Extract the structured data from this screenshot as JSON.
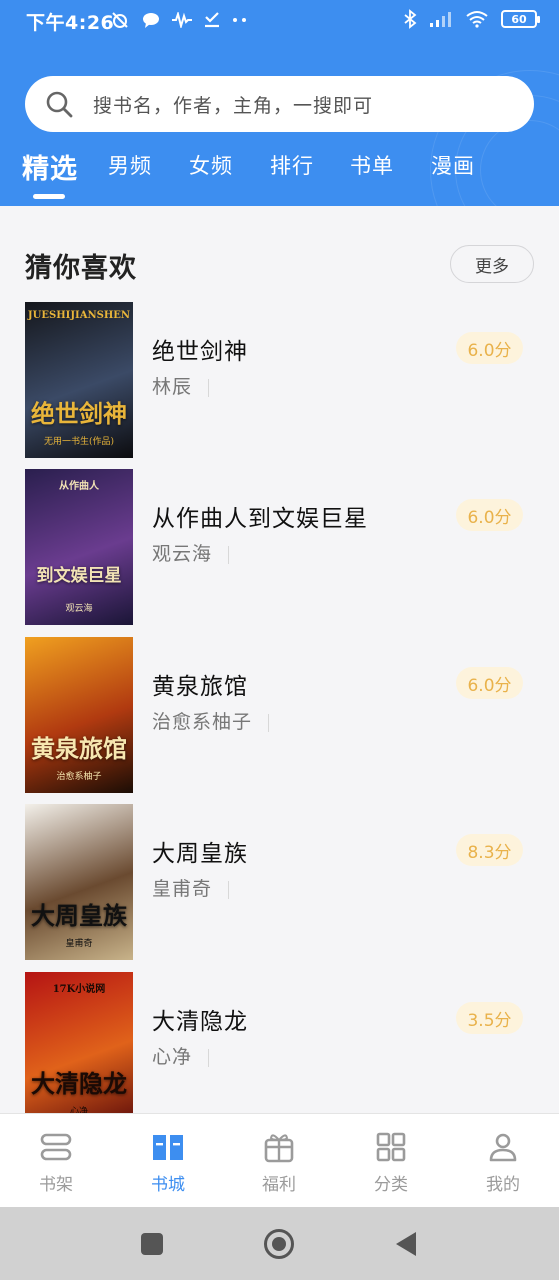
{
  "status_bar": {
    "time": "下午4:26",
    "battery": "60"
  },
  "search": {
    "placeholder": "搜书名，作者，主角，一搜即可"
  },
  "tabs": [
    {
      "label": "精选",
      "active": true
    },
    {
      "label": "男频",
      "active": false
    },
    {
      "label": "女频",
      "active": false
    },
    {
      "label": "排行",
      "active": false
    },
    {
      "label": "书单",
      "active": false
    },
    {
      "label": "漫画",
      "active": false
    }
  ],
  "section": {
    "title": "猜你喜欢",
    "more_label": "更多"
  },
  "books": [
    {
      "title": "绝世剑神",
      "author": "林辰",
      "score": "6.0分",
      "cover_text": "绝世剑神",
      "cover_sub": "JUESHIJIANSHEN",
      "cover_author": "无用一书生(作品)",
      "cover_colors": [
        "#15171c",
        "#3b4a66",
        "#0c0c0f"
      ],
      "cover_text_color": "#e8b53a"
    },
    {
      "title": "从作曲人到文娱巨星",
      "author": "观云海",
      "score": "6.0分",
      "cover_text": "到文娱巨星",
      "cover_sub": "从作曲人",
      "cover_author": "观云海",
      "cover_colors": [
        "#2a1f4e",
        "#6a3c8f",
        "#1a1536"
      ],
      "cover_text_color": "#f2e3b5"
    },
    {
      "title": "黄泉旅馆",
      "author": "治愈系柚子",
      "score": "6.0分",
      "cover_text": "黄泉旅馆",
      "cover_sub": "",
      "cover_author": "治愈系柚子",
      "cover_colors": [
        "#f0a020",
        "#b13a10",
        "#1b0d05"
      ],
      "cover_text_color": "#f7e7b0"
    },
    {
      "title": "大周皇族",
      "author": "皇甫奇",
      "score": "8.3分",
      "cover_text": "大周皇族",
      "cover_sub": "",
      "cover_author": "皇甫奇",
      "cover_colors": [
        "#f3f0ea",
        "#6a4a30",
        "#c8b38a"
      ],
      "cover_text_color": "#111111"
    },
    {
      "title": "大清隐龙",
      "author": "心净",
      "score": "3.5分",
      "cover_text": "大清隐龙",
      "cover_sub": "17K小说网",
      "cover_author": "心净",
      "cover_colors": [
        "#b51414",
        "#e0621a",
        "#5a0a0a"
      ],
      "cover_text_color": "#1a0a05"
    }
  ],
  "bottom_nav": [
    {
      "label": "书架",
      "icon": "bookshelf-icon",
      "active": false
    },
    {
      "label": "书城",
      "icon": "book-store-icon",
      "active": true
    },
    {
      "label": "福利",
      "icon": "gift-icon",
      "active": false
    },
    {
      "label": "分类",
      "icon": "category-grid-icon",
      "active": false
    },
    {
      "label": "我的",
      "icon": "profile-icon",
      "active": false
    }
  ],
  "colors": {
    "accent": "#3d8ef0",
    "score_bg": "#fdf3dc",
    "score_text": "#e9b24b"
  }
}
